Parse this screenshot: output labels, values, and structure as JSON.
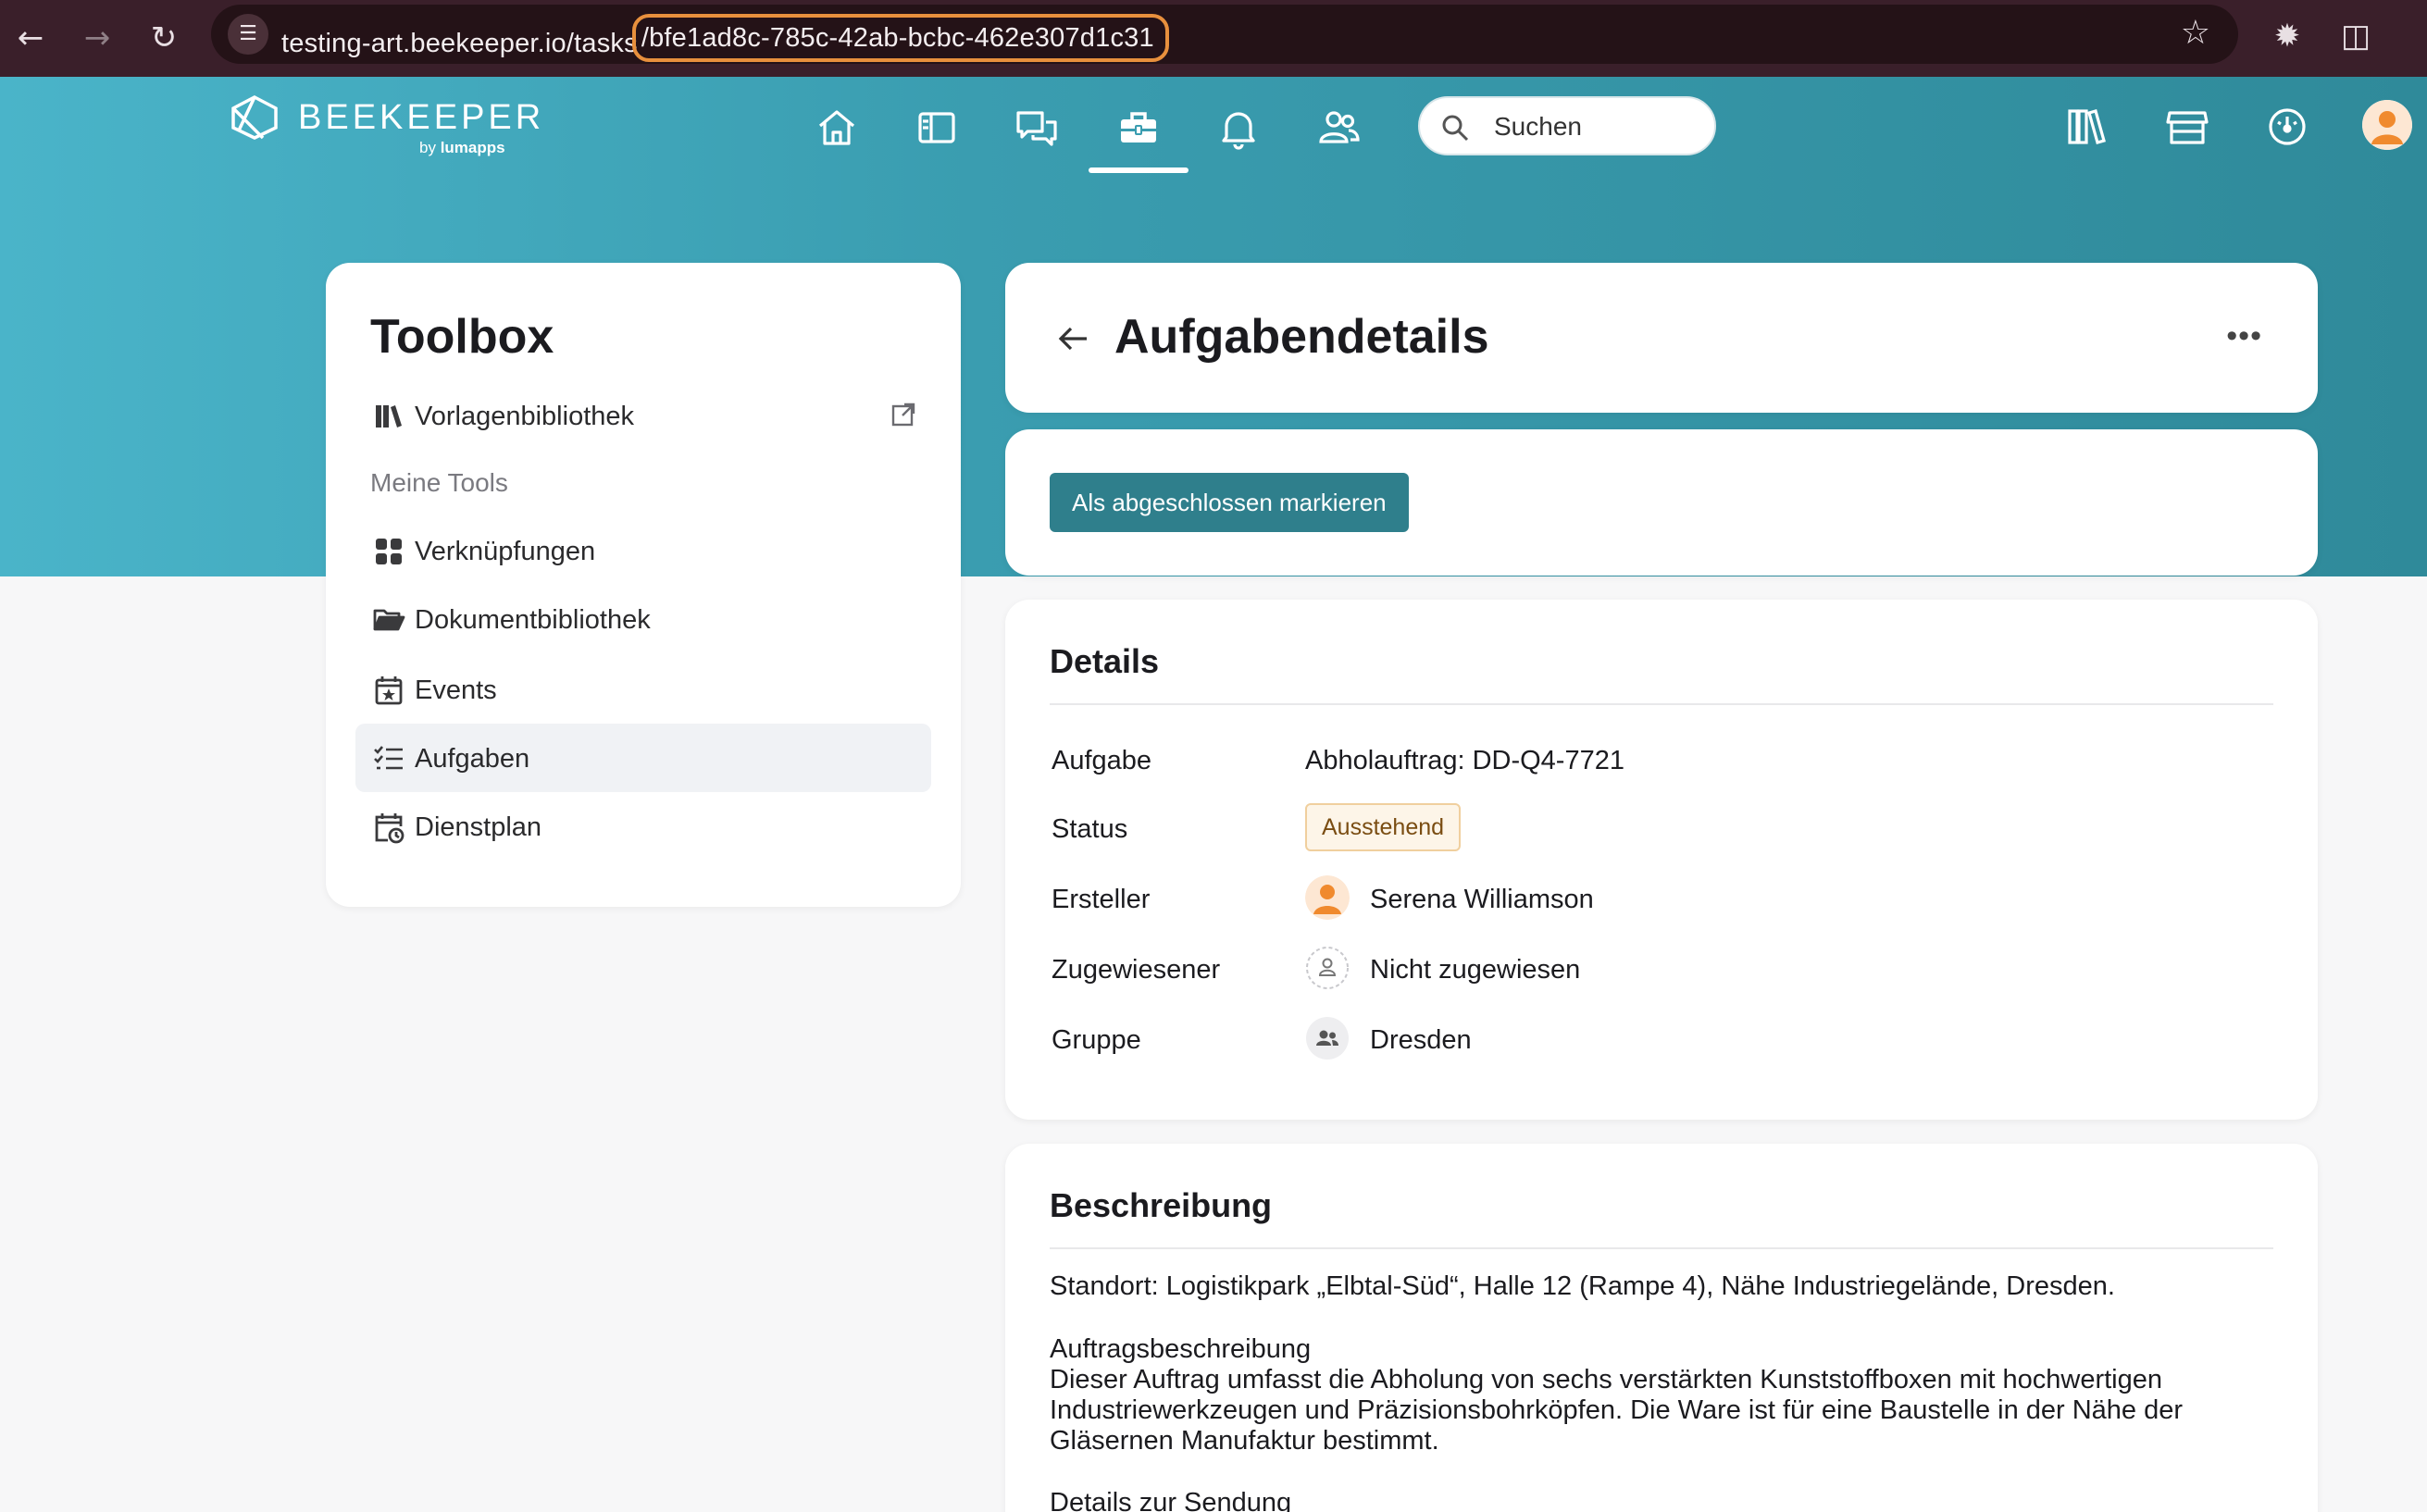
{
  "browser": {
    "url_prefix": "testing-art.beekeeper.io/tasks",
    "url_id": "/bfe1ad8c-785c-42ab-bcbc-462e307d1c31"
  },
  "app": {
    "brand": "BEEKEEPER",
    "brand_by": "by",
    "brand_partner": "lumapps",
    "search_placeholder": "Suchen",
    "accent_color": "#2f7f8c"
  },
  "toolbox": {
    "title": "Toolbox",
    "template_library": "Vorlagenbibliothek",
    "section_label": "Meine Tools",
    "items": [
      {
        "label": "Verknüpfungen",
        "icon": "grid-icon"
      },
      {
        "label": "Dokumentbibliothek",
        "icon": "folder-icon"
      },
      {
        "label": "Events",
        "icon": "calendar-star-icon"
      },
      {
        "label": "Aufgaben",
        "icon": "checklist-icon",
        "active": true
      },
      {
        "label": "Dienstplan",
        "icon": "calendar-clock-icon"
      }
    ]
  },
  "task": {
    "page_title": "Aufgabendetails",
    "complete_button": "Als abgeschlossen markieren",
    "details_title": "Details",
    "fields": {
      "task_label": "Aufgabe",
      "task_value": "Abholauftrag: DD-Q4-7721",
      "status_label": "Status",
      "status_value": "Ausstehend",
      "creator_label": "Ersteller",
      "creator_value": "Serena Williamson",
      "assignee_label": "Zugewiesener",
      "assignee_value": "Nicht zugewiesen",
      "group_label": "Gruppe",
      "group_value": "Dresden"
    },
    "description_title": "Beschreibung",
    "description": {
      "line1": "Standort: Logistikpark „Elbtal-Süd“, Halle 12 (Rampe 4), Nähe Industriegelände, Dresden.",
      "heading": "Auftragsbeschreibung",
      "body1": "Dieser Auftrag umfasst die Abholung von sechs verstärkten Kunststoffboxen mit hochwertigen",
      "body2": "Industriewerkzeugen und Präzisionsbohrköpfen. Die Ware ist für eine Baustelle in der Nähe der",
      "body3": "Gläsernen Manufaktur bestimmt.",
      "heading2": "Details zur Sendung"
    }
  }
}
